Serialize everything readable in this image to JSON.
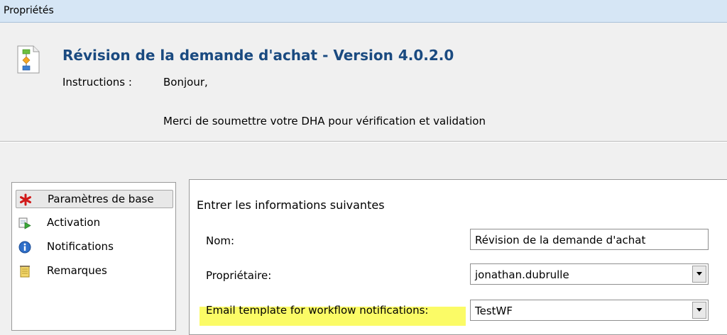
{
  "window": {
    "title": "Propriétés"
  },
  "header": {
    "icon": "workflow-document-icon",
    "title": "Révision de la demande d'achat - Version 4.0.2.0",
    "instructions_label": "Instructions :",
    "instructions_line1": "Bonjour,",
    "instructions_line2": "Merci de soumettre votre DHA pour vérification et validation"
  },
  "sidebar": {
    "items": [
      {
        "label": "Paramètres de base",
        "icon": "red-asterisk-icon",
        "selected": true
      },
      {
        "label": "Activation",
        "icon": "activation-icon",
        "selected": false
      },
      {
        "label": "Notifications",
        "icon": "info-icon",
        "selected": false
      },
      {
        "label": "Remarques",
        "icon": "notes-icon",
        "selected": false
      }
    ]
  },
  "form": {
    "section_title": "Entrer les informations suivantes",
    "name_label": "Nom:",
    "name_value": "Révision de la demande d'achat",
    "owner_label": "Propriétaire:",
    "owner_value": "jonathan.dubrulle",
    "email_template_label": "Email template for workflow notifications:",
    "email_template_value": "TestWF"
  },
  "colors": {
    "title_blue": "#1a4a80",
    "highlight_yellow": "#fbfb66",
    "titlebar_bg": "#d6e6f5"
  }
}
